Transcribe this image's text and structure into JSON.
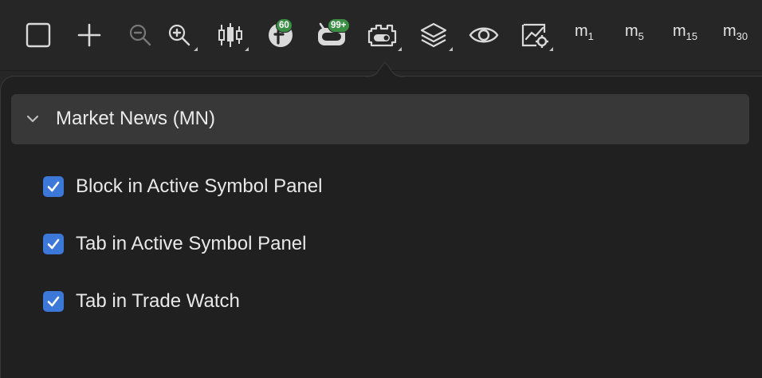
{
  "toolbar": {
    "items": [
      {
        "icon": "square-icon"
      },
      {
        "icon": "plus-icon"
      },
      {
        "icon": "zoom-out-icon"
      },
      {
        "icon": "zoom-in-icon"
      },
      {
        "icon": "candlestick-chart-icon"
      },
      {
        "icon": "indicator-icon",
        "badge": "60"
      },
      {
        "icon": "robot-icon",
        "badge": "99+"
      },
      {
        "icon": "settings-toggle-icon"
      },
      {
        "icon": "layers-icon"
      },
      {
        "icon": "eye-icon"
      },
      {
        "icon": "chart-settings-icon"
      }
    ],
    "indicator_badge": "60",
    "robot_badge": "99+",
    "timeframes": [
      {
        "label": "m",
        "sub": "1"
      },
      {
        "label": "m",
        "sub": "5"
      },
      {
        "label": "m",
        "sub": "15"
      },
      {
        "label": "m",
        "sub": "30"
      }
    ]
  },
  "panel": {
    "section_title": "Market News (MN)",
    "options": [
      {
        "label": "Block in Active Symbol Panel",
        "checked": true
      },
      {
        "label": "Tab in Active Symbol Panel",
        "checked": true
      },
      {
        "label": "Tab in Trade Watch",
        "checked": true
      }
    ]
  },
  "colors": {
    "background": "#262626",
    "popover": "#202020",
    "section_header": "#383838",
    "checkbox": "#3c78d8",
    "badge": "#3a8f45"
  }
}
